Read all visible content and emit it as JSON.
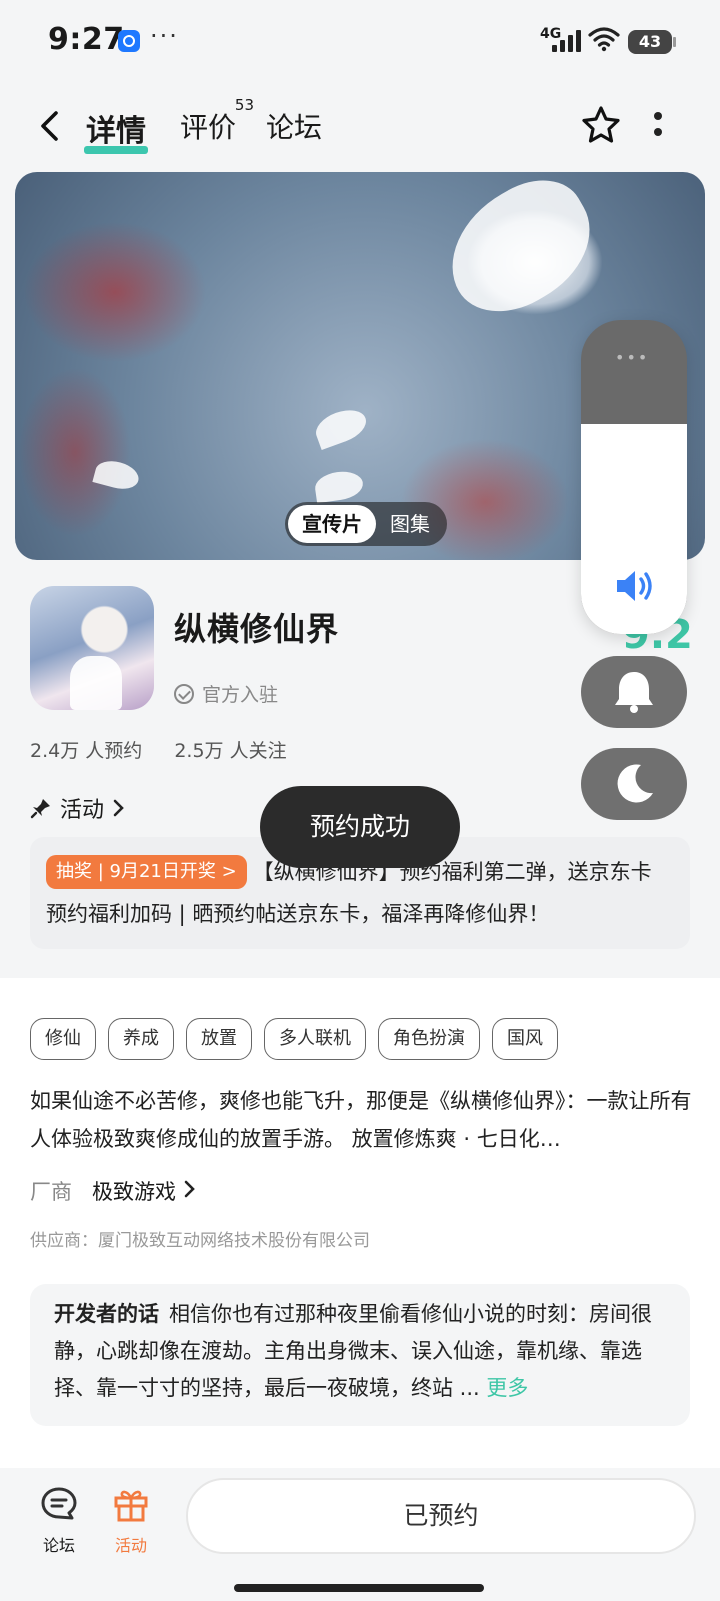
{
  "status_bar": {
    "time": "9:27",
    "dots": "···",
    "network": "4G",
    "battery": "43"
  },
  "nav": {
    "tabs": [
      {
        "label": "详情",
        "active": true
      },
      {
        "label": "评价",
        "badge": "53"
      },
      {
        "label": "论坛"
      }
    ]
  },
  "banner": {
    "segments": [
      "宣传片",
      "图集"
    ],
    "selected": "宣传片"
  },
  "app": {
    "name": "纵横修仙界",
    "official": "官方入驻",
    "score": "9.2",
    "reservations": "2.4万 人预约",
    "followers": "2.5万 人关注"
  },
  "activity": {
    "heading": "活动",
    "tag": "抽奖 | 9月21日开奖 >",
    "text": "【纵横修仙界】预约福利第二弹，送京东卡 预约福利加码 | 晒预约帖送京东卡，福泽再降修仙界！"
  },
  "toast": "预约成功",
  "tags": [
    "修仙",
    "养成",
    "放置",
    "多人联机",
    "角色扮演",
    "国风"
  ],
  "description": "如果仙途不必苦修，爽修也能飞升，那便是《纵横修仙界》：一款让所有人体验极致爽修成仙的放置手游。 放置修炼爽 · 七日化…",
  "vendor": {
    "key": "厂商",
    "value": "极致游戏"
  },
  "supplier": "供应商：厦门极致互动网络技术股份有限公司",
  "developer": {
    "label": "开发者的话",
    "text": "相信你也有过那种夜里偷看修仙小说的时刻：房间很静，心跳却像在渡劫。主角出身微末、误入仙途，靠机缘、靠选择、靠一寸寸的坚持，最后一夜破境，终站 ...",
    "more": "更多"
  },
  "bottom": {
    "forum_label": "论坛",
    "activity_label": "活动",
    "reserve_button": "已预约"
  },
  "colors": {
    "accent": "#3ec6a6",
    "orange": "#f27a3f"
  }
}
